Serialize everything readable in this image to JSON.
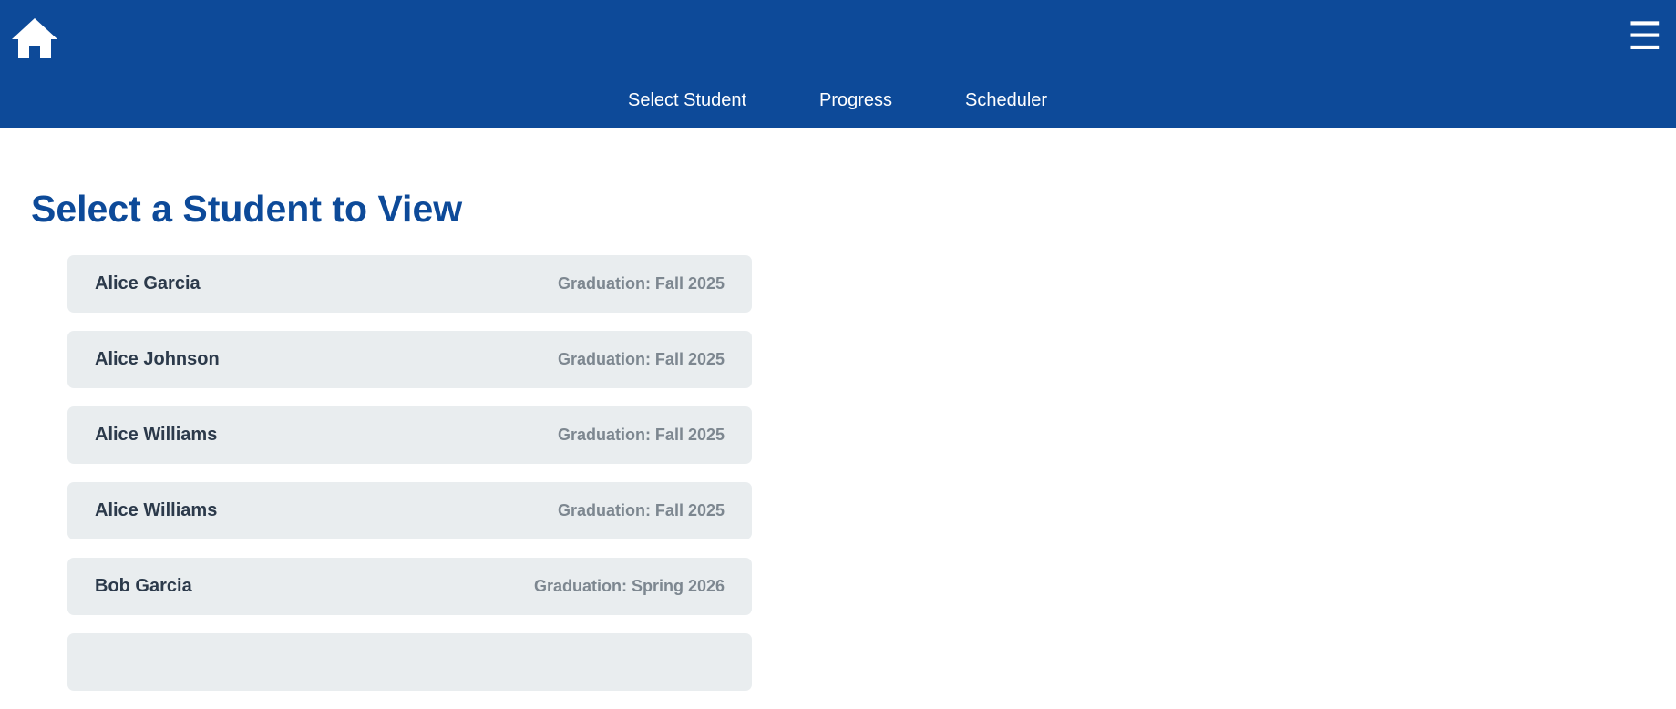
{
  "header": {
    "home_icon": "home-icon",
    "menu_icon": "hamburger-menu-icon",
    "menu_glyph": "☰",
    "background_color": "#0d4a99"
  },
  "nav": {
    "items": [
      {
        "label": "Select Student"
      },
      {
        "label": "Progress"
      },
      {
        "label": "Scheduler"
      }
    ]
  },
  "main": {
    "title": "Select a Student to View",
    "students": [
      {
        "name": "Alice Garcia",
        "graduation": "Graduation: Fall 2025"
      },
      {
        "name": "Alice Johnson",
        "graduation": "Graduation: Fall 2025"
      },
      {
        "name": "Alice Williams",
        "graduation": "Graduation: Fall 2025"
      },
      {
        "name": "Alice Williams",
        "graduation": "Graduation: Fall 2025"
      },
      {
        "name": "Bob Garcia",
        "graduation": "Graduation: Spring 2026"
      }
    ]
  }
}
